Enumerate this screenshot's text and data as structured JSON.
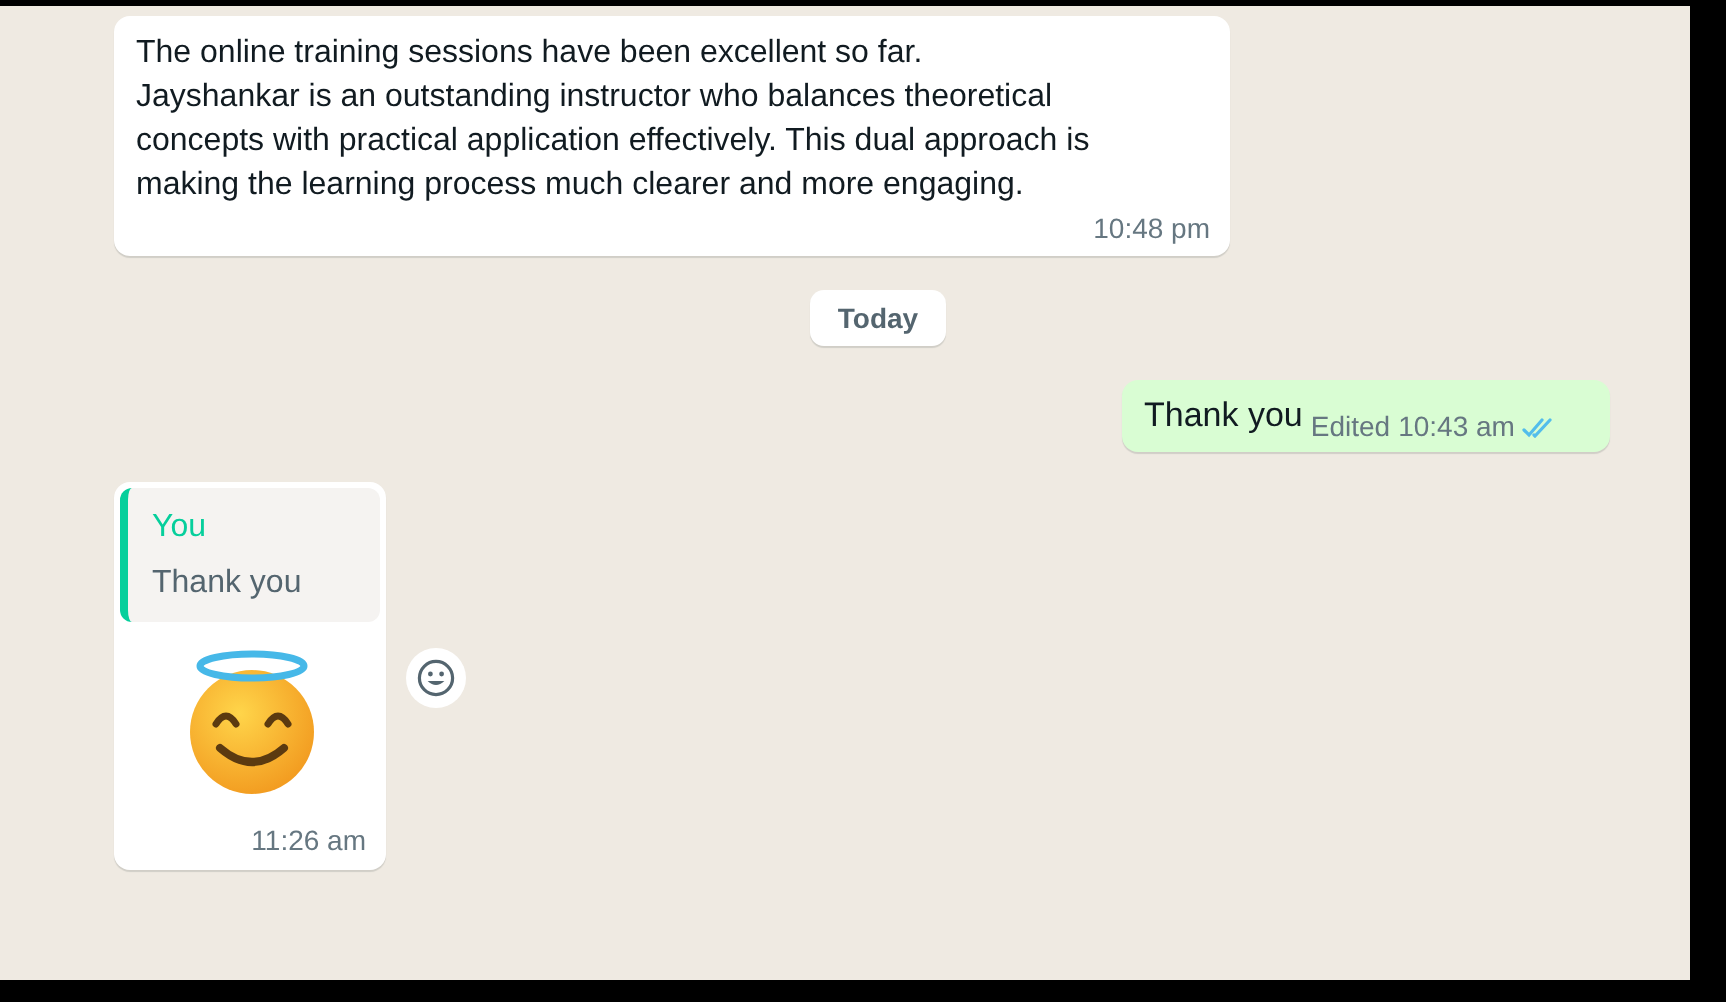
{
  "messages": [
    {
      "kind": "incoming_text",
      "text": "The online training sessions have been excellent so far.\nJayshankar is an outstanding instructor who balances theoretical\nconcepts with practical application effectively. This dual approach is\nmaking the learning process much clearer and more engaging.",
      "time": "10:48 pm"
    },
    {
      "kind": "date",
      "text": "Today"
    },
    {
      "kind": "outgoing_text",
      "text": "Thank you",
      "edited": "Edited",
      "time": "10:43 am",
      "read": true
    },
    {
      "kind": "incoming_reply",
      "quote_author": "You",
      "quote_text": "Thank you",
      "time": "11:26 am"
    }
  ]
}
